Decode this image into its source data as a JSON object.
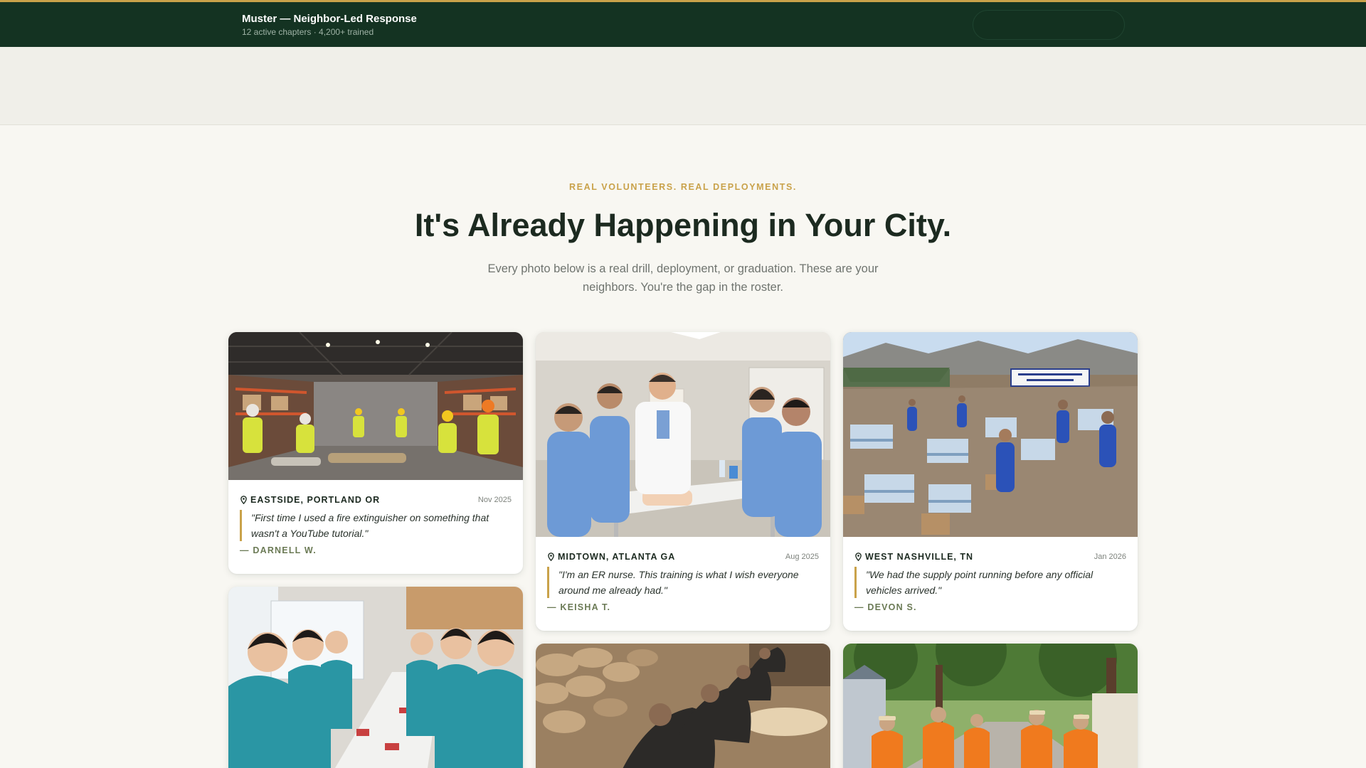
{
  "header": {
    "title": "Muster — Neighbor-Led Response",
    "subtitle": "12 active chapters · 4,200+ trained"
  },
  "section": {
    "eyebrow": "REAL VOLUNTEERS. REAL DEPLOYMENTS.",
    "headline": "It's Already Happening in Your City.",
    "lede": "Every photo below is a real drill, deployment, or graduation. These are your neighbors. You're the gap in the roster."
  },
  "stories": [
    {
      "location": "EASTSIDE, PORTLAND OR",
      "date": "Nov 2025",
      "quote": "\"First time I used a fire extinguisher on something that wasn't a YouTube tutorial.\"",
      "author": "— DARNELL W."
    },
    {
      "location": "MIDTOWN, ATLANTA GA",
      "date": "Aug 2025",
      "quote": "\"I'm an ER nurse. This training is what I wish everyone around me already had.\"",
      "author": "— KEISHA T."
    },
    {
      "location": "WEST NASHVILLE, TN",
      "date": "Jan 2026",
      "quote": "\"We had the supply point running before any official vehicles arrived.\"",
      "author": "— DEVON S."
    }
  ],
  "colors": {
    "header_bg": "#143322",
    "accent_gold": "#c9a24a",
    "author_olive": "#6b7a55",
    "page_bg": "#f8f7f2"
  },
  "icons": {
    "location": "map-pin-icon"
  }
}
